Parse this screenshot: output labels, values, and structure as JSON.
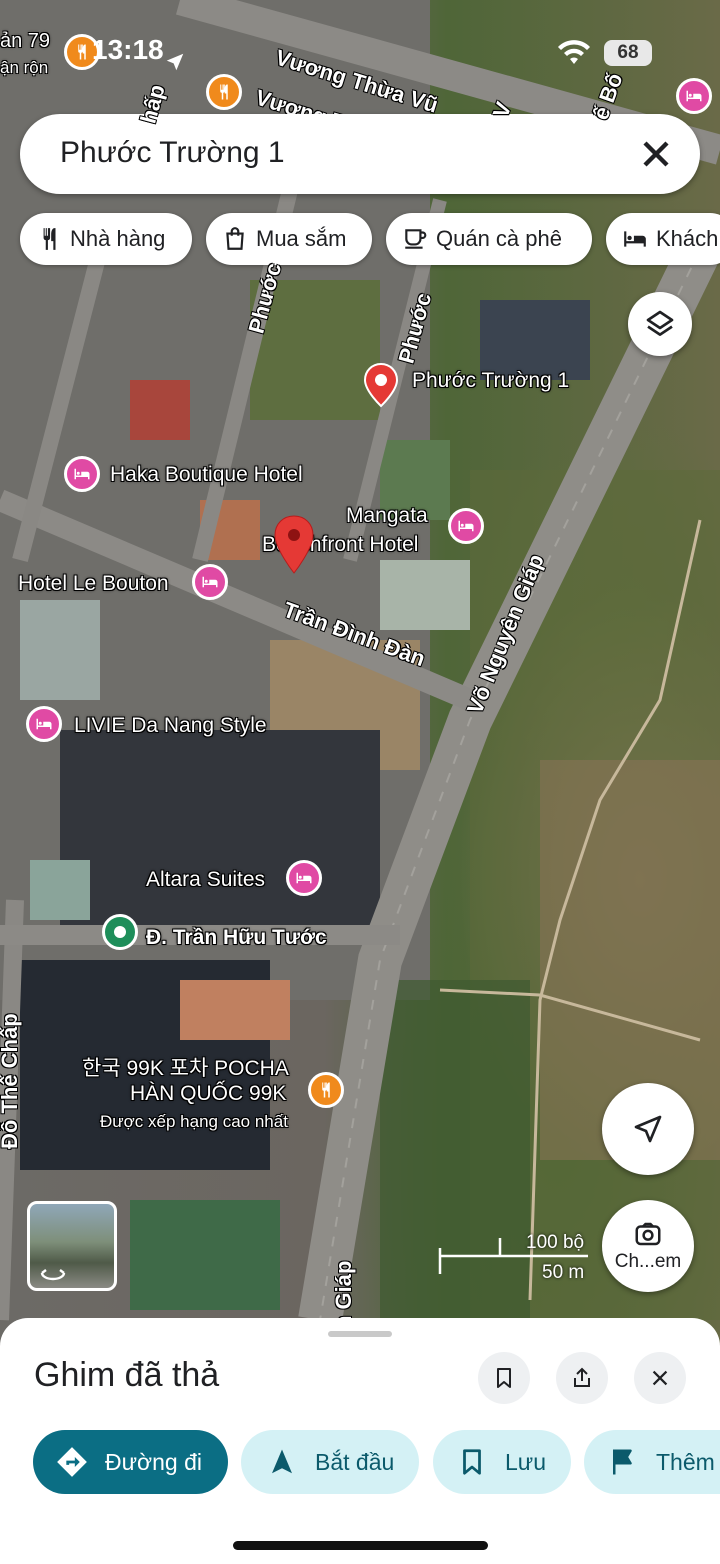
{
  "status_bar": {
    "time": "13:18",
    "battery": "68"
  },
  "search": {
    "query": "Phước Trường 1"
  },
  "chips": [
    {
      "label": "Nhà hàng",
      "icon": "fork-knife-icon"
    },
    {
      "label": "Mua sắm",
      "icon": "shopping-bag-icon"
    },
    {
      "label": "Quán cà phê",
      "icon": "coffee-cup-icon"
    },
    {
      "label": "Khách",
      "icon": "bed-icon"
    }
  ],
  "map": {
    "top_fragments": [
      "ản 79",
      "ận rộn"
    ],
    "streets": [
      "Vương Thừa Vũ",
      "Vương Thừ",
      "Trần Đình Đàn",
      "Võ Nguyên Giáp",
      "Phước",
      "Phước",
      "Đỗ Thế Chấp",
      "n Giáp",
      "hấp",
      "ế Bố",
      "V"
    ],
    "places": [
      {
        "name": "Phước Trường 1",
        "type": "red-pin"
      },
      {
        "name": "Haka Boutique Hotel",
        "type": "hotel"
      },
      {
        "name": "Mangata",
        "name2": "Beachfront Hotel",
        "type": "hotel"
      },
      {
        "name": "Hotel Le Bouton",
        "type": "hotel"
      },
      {
        "name": "LIVIE Da Nang Style",
        "type": "hotel"
      },
      {
        "name": "Altara Suites",
        "type": "hotel"
      },
      {
        "name": "Đ. Trần Hữu Tước",
        "type": "green-pin"
      },
      {
        "name": "한국 99K 포차 POCHA",
        "name2": "HÀN QUỐC 99K",
        "rating_note": "Được xếp hạng cao nhất",
        "type": "restaurant"
      }
    ],
    "scale": {
      "imperial": "100 bộ",
      "metric": "50 m"
    },
    "camera_button_label": "Ch...em"
  },
  "sheet": {
    "title": "Ghim đã thả",
    "actions": [
      {
        "label": "Đường đi",
        "icon": "directions-icon"
      },
      {
        "label": "Bắt đầu",
        "icon": "navigation-arrow-icon"
      },
      {
        "label": "Lưu",
        "icon": "bookmark-icon"
      },
      {
        "label": "Thêm",
        "icon": "flag-icon"
      }
    ]
  },
  "colors": {
    "primary": "#0b6e84",
    "secondary_bg": "#d4f1f5",
    "hotel_pin": "#e04aa4",
    "food_pin": "#f08a1c",
    "dropped_pin": "#e53935",
    "green_pin": "#1e8e5a"
  }
}
